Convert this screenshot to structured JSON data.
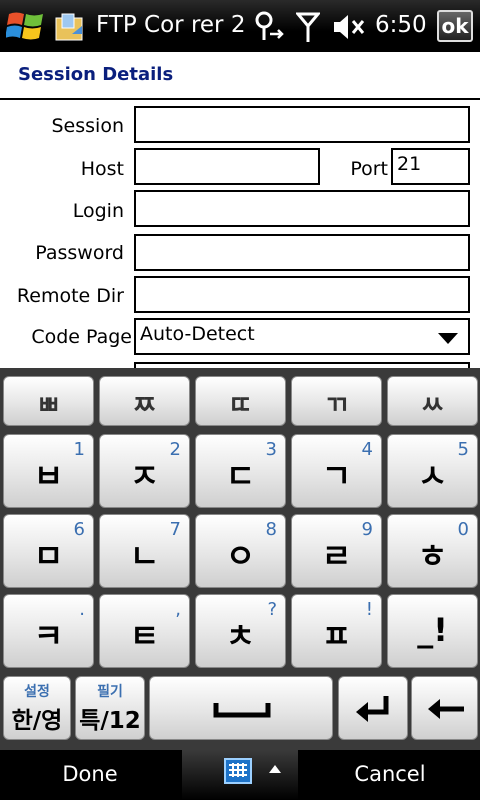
{
  "status_bar": {
    "title": "FTP Cor  rer 2",
    "time": "6:50",
    "ok_label": "ok"
  },
  "header": {
    "title": "Session Details"
  },
  "form": {
    "session_label": "Session",
    "session_value": "",
    "host_label": "Host",
    "host_value": "",
    "port_label": "Port",
    "port_value": "21",
    "login_label": "Login",
    "login_value": "",
    "password_label": "Password",
    "password_value": "",
    "remote_dir_label": "Remote Dir",
    "remote_dir_value": "",
    "code_page_label": "Code Page",
    "code_page_value": "Auto-Detect"
  },
  "keyboard": {
    "top_row": [
      "ㅃ",
      "ㅉ",
      "ㄸ",
      "ㄲ",
      "ㅆ"
    ],
    "row2": [
      {
        "main": "ㅂ",
        "sub": "1"
      },
      {
        "main": "ㅈ",
        "sub": "2"
      },
      {
        "main": "ㄷ",
        "sub": "3"
      },
      {
        "main": "ㄱ",
        "sub": "4"
      },
      {
        "main": "ㅅ",
        "sub": "5"
      }
    ],
    "row3": [
      {
        "main": "ㅁ",
        "sub": "6"
      },
      {
        "main": "ㄴ",
        "sub": "7"
      },
      {
        "main": "ㅇ",
        "sub": "8"
      },
      {
        "main": "ㄹ",
        "sub": "9"
      },
      {
        "main": "ㅎ",
        "sub": "0"
      }
    ],
    "row4": [
      {
        "main": "ㅋ",
        "sub": "."
      },
      {
        "main": "ㅌ",
        "sub": ","
      },
      {
        "main": "ㅊ",
        "sub": "?"
      },
      {
        "main": "ㅍ",
        "sub": "!"
      },
      {
        "main": "_!",
        "sub": ""
      }
    ],
    "lang_small": "설정",
    "lang_big": "한/영",
    "sym_small": "필기",
    "sym_big": "특/12"
  },
  "bottom_bar": {
    "done_label": "Done",
    "cancel_label": "Cancel"
  }
}
